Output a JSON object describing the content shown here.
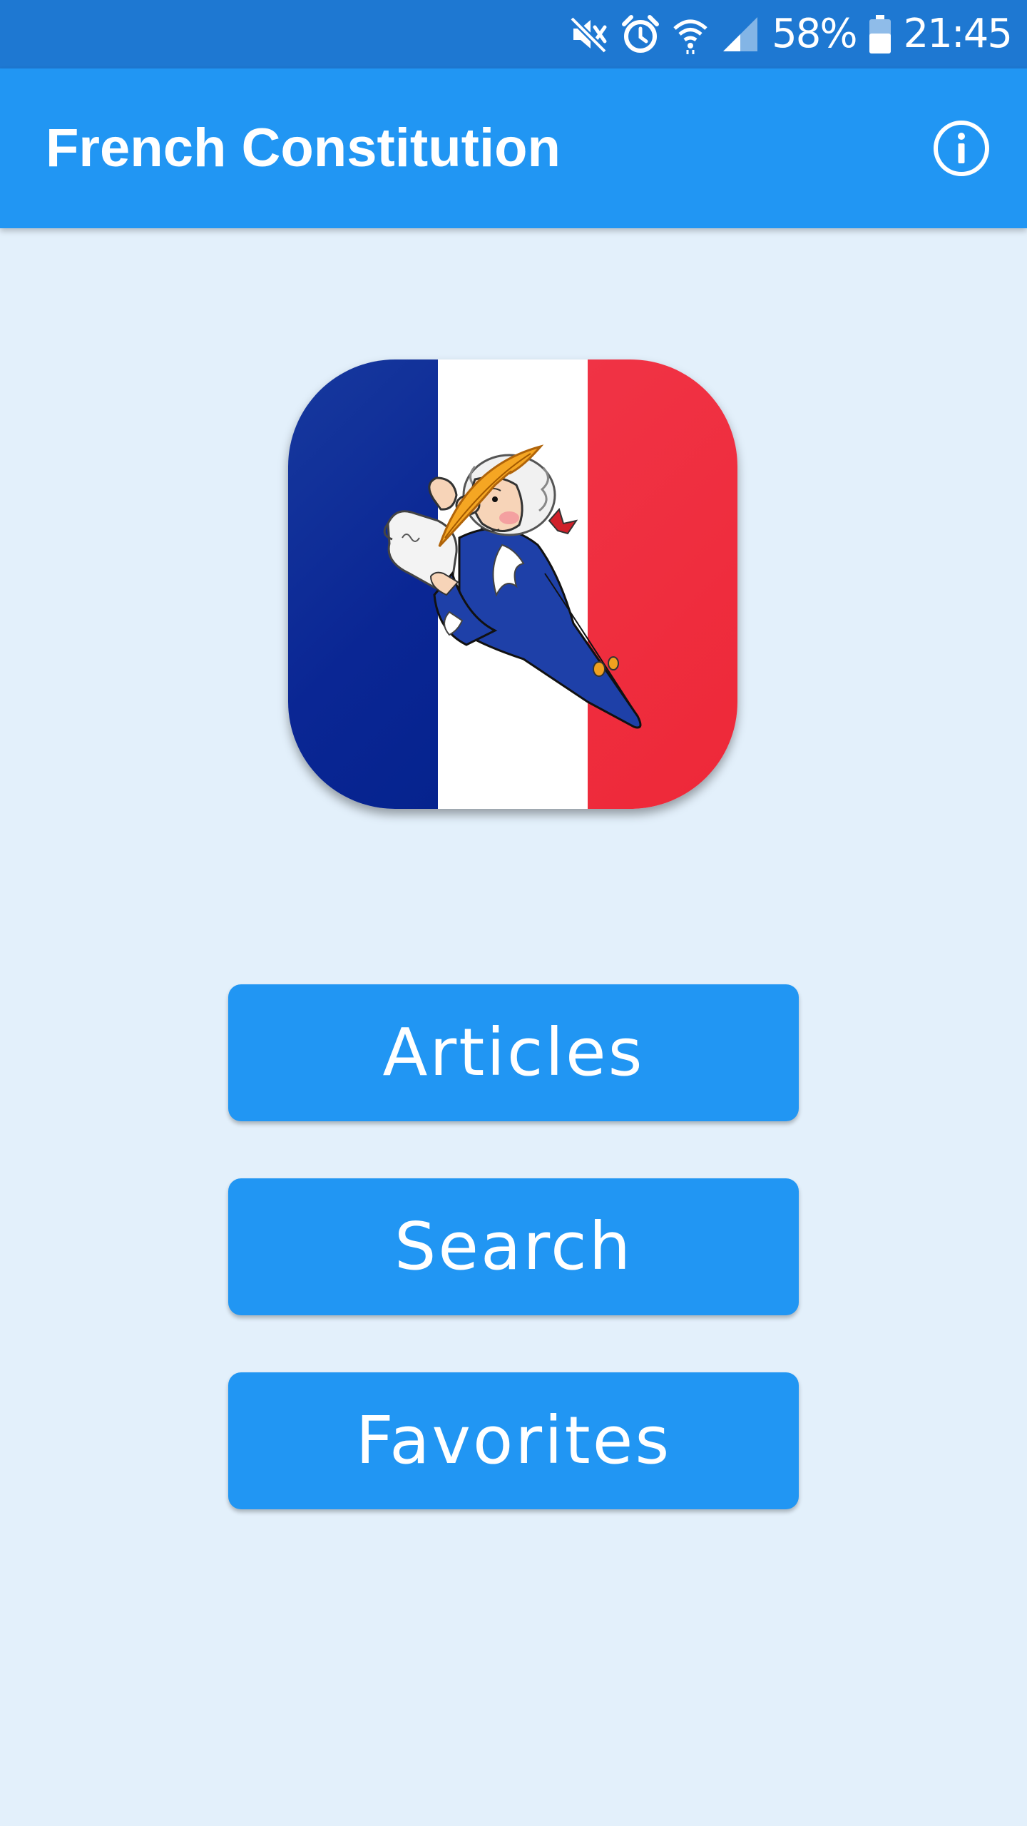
{
  "status_bar": {
    "battery": "58%",
    "time": "21:45",
    "icons": [
      "mute-icon",
      "alarm-icon",
      "wifi-icon",
      "signal-icon",
      "battery-icon"
    ]
  },
  "app_bar": {
    "title": "French Constitution",
    "info_icon": "info-icon"
  },
  "logo": {
    "flag_colors": [
      "#0a2694",
      "#ffffff",
      "#ee2838"
    ]
  },
  "menu": {
    "articles": "Articles",
    "search": "Search",
    "favorites": "Favorites"
  },
  "colors": {
    "status_bar": "#1e78d2",
    "app_bar": "#2196f3",
    "background": "#e3f0fb",
    "button": "#2196f3"
  }
}
